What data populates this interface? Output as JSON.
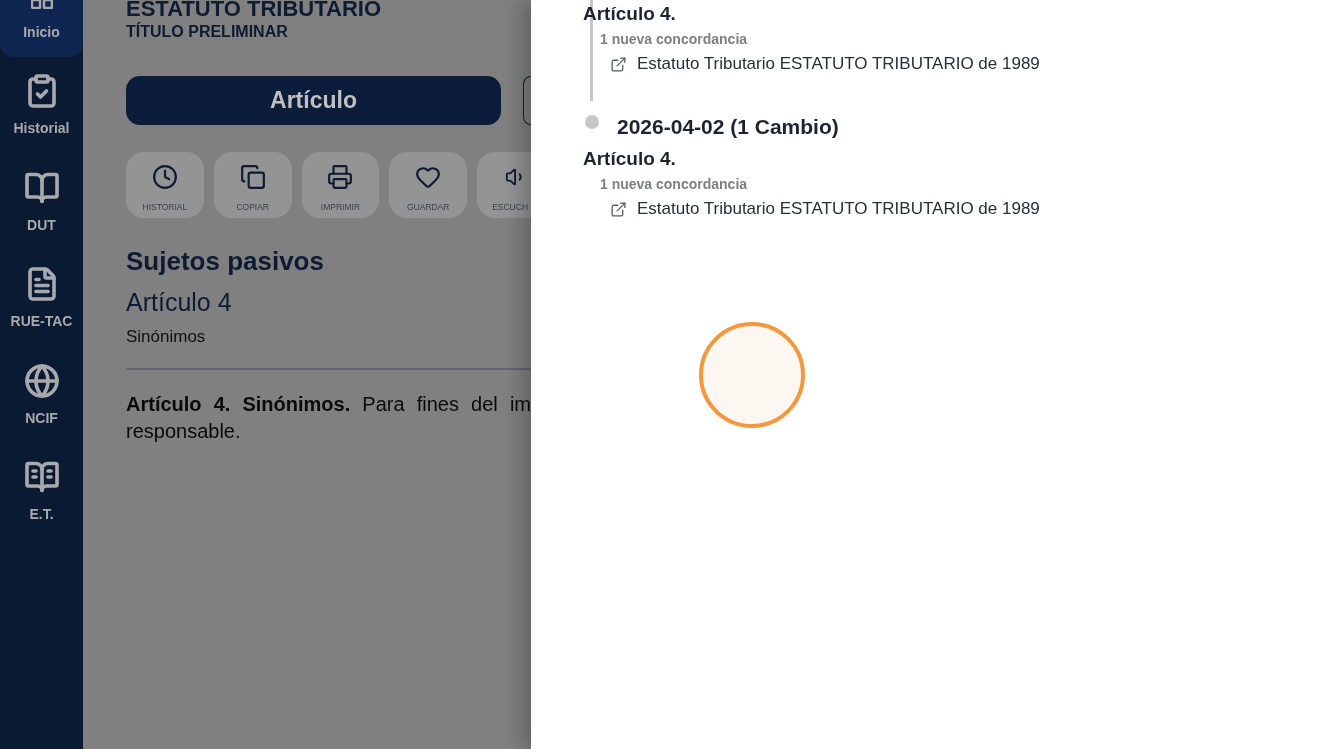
{
  "sidebar": {
    "items": [
      {
        "label": "Inicio",
        "selected": true
      },
      {
        "label": "Historial",
        "selected": false
      },
      {
        "label": "DUT",
        "selected": false
      },
      {
        "label": "RUE-TAC",
        "selected": false
      },
      {
        "label": "NCIF",
        "selected": false
      },
      {
        "label": "E.T.",
        "selected": false
      }
    ]
  },
  "header": {
    "title": "ESTATUTO TRIBUTARIO",
    "subtitle": "TÍTULO PRELIMINAR"
  },
  "view_tabs": [
    {
      "label": "Artículo",
      "selected": true
    },
    {
      "selected": false
    }
  ],
  "actions": [
    {
      "label": "HISTORIAL"
    },
    {
      "label": "COPIAR"
    },
    {
      "label": "IMPRIMIR"
    },
    {
      "label": "GUARDAR"
    },
    {
      "label": "ESCUCH"
    }
  ],
  "article": {
    "heading": "Sujetos pasivos",
    "number": "Artículo 4",
    "name": "Sinónimos",
    "text_lines": [
      "**Artículo 4. Sinónimos.** Para fines del im",
      "responsable."
    ]
  },
  "drawer": {
    "timeline": [
      {
        "article": "Artículo 4.",
        "count": "1 nueva concordancia",
        "links": [
          "Estatuto Tributario ESTATUTO TRIBUTARIO de 1989"
        ]
      },
      {
        "date": "2026-04-02 (1 Cambio)",
        "article": "Artículo 4.",
        "count": "1 nueva concordancia",
        "links": [
          "Estatuto Tributario ESTATUTO TRIBUTARIO de 1989"
        ]
      }
    ]
  }
}
